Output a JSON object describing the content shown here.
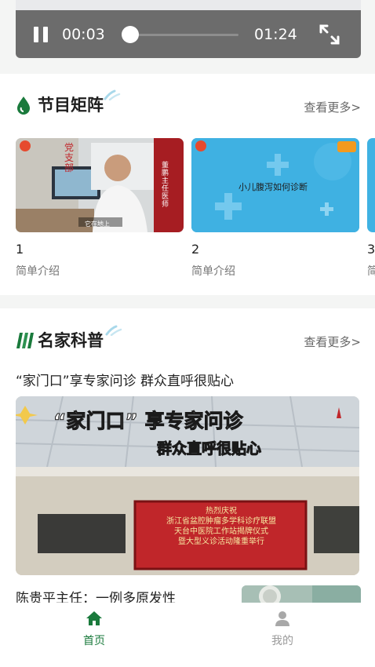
{
  "player": {
    "current_time": "00:03",
    "total_time": "01:24",
    "progress": 0.04
  },
  "program_section": {
    "title": "节目矩阵",
    "more": "查看更多>",
    "items": [
      {
        "num": "1",
        "desc": "简单介绍",
        "overlay_left": "党\n支\n部",
        "name_card": "董鹏 主任医师",
        "caption": "它在地上"
      },
      {
        "num": "2",
        "desc": "简单介绍",
        "overlay": "小儿腹泻如何诊断"
      },
      {
        "num": "3",
        "desc": "简单介绍"
      }
    ]
  },
  "expert_section": {
    "title": "名家科普",
    "more": "查看更多>",
    "article1": {
      "title": "“家门口”享专家问诊 群众直呼很贴心",
      "image_headline_1": "“家门口” 享专家问诊",
      "image_headline_2": "群众直呼很贴心",
      "banner_lines": [
        "热烈庆祝",
        "浙江省盆腔肿瘤多学科诊疗联盟",
        "天台中医院工作站揭牌仪式",
        "暨大型义诊活动隆重举行"
      ]
    },
    "article2": {
      "title": "陈贵平主任：一例多原发性"
    }
  },
  "nav": {
    "home": "首页",
    "mine": "我的",
    "active_color": "#1a7a3c",
    "inactive_color": "#9a9a9a"
  },
  "colors": {
    "accent": "#1a7a3c",
    "ribbon_red": "#a61d22",
    "banner_red": "#c0262a"
  }
}
